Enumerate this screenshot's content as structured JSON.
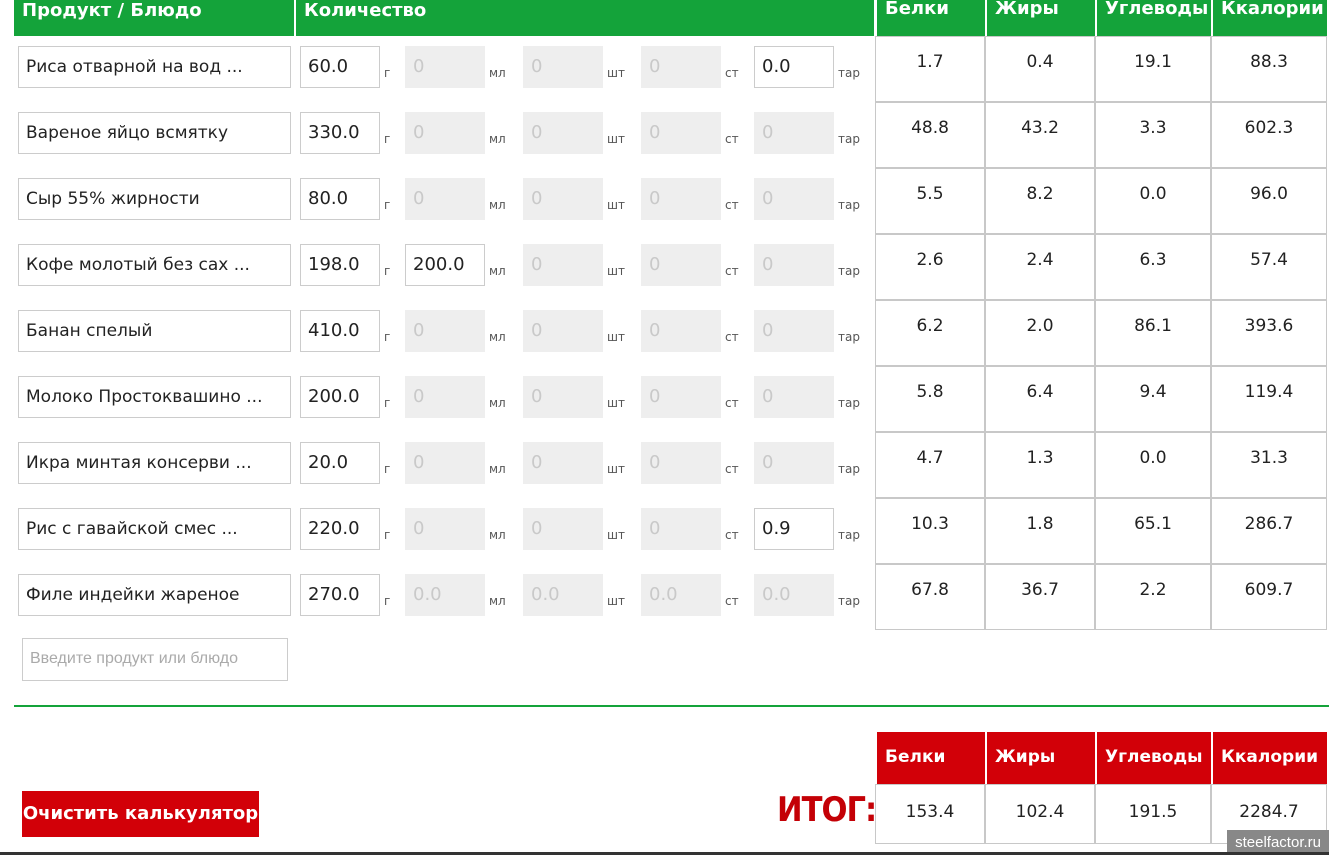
{
  "headers": {
    "product": "Продукт / Блюдо",
    "quantity": "Количество",
    "protein": "Белки",
    "fat": "Жиры",
    "carbs": "Углеводы",
    "kcal": "Ккалории"
  },
  "units": {
    "g": "г",
    "ml": "мл",
    "pcs": "шт",
    "st": "ст",
    "tar": "тар"
  },
  "rows": [
    {
      "name": "Риса отварной на вод ...",
      "g": "60.0",
      "ml": "0",
      "pcs": "0",
      "st": "0",
      "tar": "0.0",
      "tar_on": true,
      "ml_on": false,
      "p": "1.7",
      "f": "0.4",
      "c": "19.1",
      "k": "88.3"
    },
    {
      "name": "Вареное яйцо всмятку",
      "g": "330.0",
      "ml": "0",
      "pcs": "0",
      "st": "0",
      "tar": "0",
      "tar_on": false,
      "ml_on": false,
      "p": "48.8",
      "f": "43.2",
      "c": "3.3",
      "k": "602.3"
    },
    {
      "name": "Сыр 55% жирности",
      "g": "80.0",
      "ml": "0",
      "pcs": "0",
      "st": "0",
      "tar": "0",
      "tar_on": false,
      "ml_on": false,
      "p": "5.5",
      "f": "8.2",
      "c": "0.0",
      "k": "96.0"
    },
    {
      "name": "Кофе молотый без сах ...",
      "g": "198.0",
      "ml": "200.0",
      "pcs": "0",
      "st": "0",
      "tar": "0",
      "tar_on": false,
      "ml_on": true,
      "p": "2.6",
      "f": "2.4",
      "c": "6.3",
      "k": "57.4"
    },
    {
      "name": "Банан спелый",
      "g": "410.0",
      "ml": "0",
      "pcs": "0",
      "st": "0",
      "tar": "0",
      "tar_on": false,
      "ml_on": false,
      "p": "6.2",
      "f": "2.0",
      "c": "86.1",
      "k": "393.6"
    },
    {
      "name": "Молоко Простоквашино ...",
      "g": "200.0",
      "ml": "0",
      "pcs": "0",
      "st": "0",
      "tar": "0",
      "tar_on": false,
      "ml_on": false,
      "p": "5.8",
      "f": "6.4",
      "c": "9.4",
      "k": "119.4"
    },
    {
      "name": "Икра минтая консерви ...",
      "g": "20.0",
      "ml": "0",
      "pcs": "0",
      "st": "0",
      "tar": "0",
      "tar_on": false,
      "ml_on": false,
      "p": "4.7",
      "f": "1.3",
      "c": "0.0",
      "k": "31.3"
    },
    {
      "name": "Рис с гавайской смес ...",
      "g": "220.0",
      "ml": "0",
      "pcs": "0",
      "st": "0",
      "tar": "0.9",
      "tar_on": true,
      "ml_on": false,
      "p": "10.3",
      "f": "1.8",
      "c": "65.1",
      "k": "286.7"
    },
    {
      "name": "Филе индейки жареное",
      "g": "270.0",
      "ml": "0.0",
      "pcs": "0.0",
      "st": "0.0",
      "tar": "0.0",
      "tar_on": false,
      "ml_on": false,
      "p": "67.8",
      "f": "36.7",
      "c": "2.2",
      "k": "609.7"
    }
  ],
  "new_product_placeholder": "Введите продукт или блюдо",
  "clear_button": "Очистить калькулятор",
  "total_label": "ИТОГ:",
  "totals": {
    "protein": "153.4",
    "fat": "102.4",
    "carbs": "191.5",
    "kcal": "2284.7"
  },
  "watermark": "steelfactor.ru",
  "colors": {
    "green": "#14a33a",
    "red": "#d20008"
  }
}
